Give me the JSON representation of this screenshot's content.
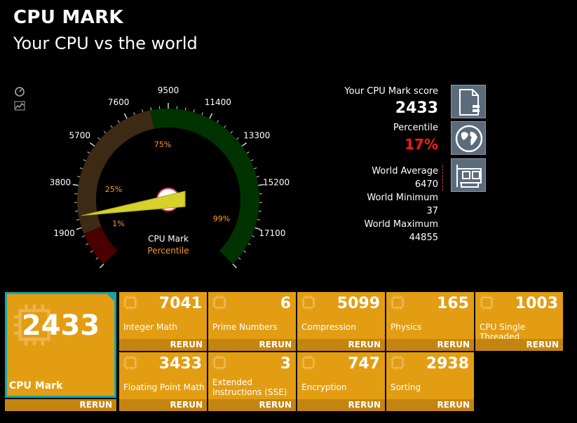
{
  "header": {
    "title": "CPU MARK",
    "subtitle": "Your CPU vs the world"
  },
  "gauge": {
    "ticks": [
      "0",
      "1900",
      "3800",
      "5700",
      "7600",
      "9500",
      "11400",
      "13300",
      "15200",
      "17100",
      "19000"
    ],
    "max": 19000,
    "percentile_marks": [
      "1%",
      "25%",
      "75%",
      "99%"
    ],
    "caption_mark": "CPU Mark",
    "caption_percentile": "Percentile",
    "needle_value": 2433,
    "colors": {
      "low": "#4a0000",
      "mid": "#3d2a14",
      "high": "#003300",
      "needle": "#d6d22a",
      "accent": "#ff8c1a"
    }
  },
  "stats": {
    "score_label": "Your CPU Mark score",
    "score": "2433",
    "percentile_label": "Percentile",
    "percentile": "17%",
    "avg_label": "World Average",
    "avg": "6470",
    "min_label": "World Minimum",
    "min": "37",
    "max_label": "World Maximum",
    "max": "44855"
  },
  "icons": {
    "left": [
      "speedometer-icon",
      "chart-icon"
    ],
    "right": [
      "report-icon",
      "globe-icon",
      "hardware-icon"
    ]
  },
  "main_tile": {
    "value": "2433",
    "label": "CPU Mark",
    "rerun": "RERUN"
  },
  "tests": [
    {
      "value": "7041",
      "label": "Integer Math",
      "rerun": "RERUN"
    },
    {
      "value": "6",
      "label": "Prime Numbers",
      "rerun": "RERUN"
    },
    {
      "value": "5099",
      "label": "Compression",
      "rerun": "RERUN"
    },
    {
      "value": "165",
      "label": "Physics",
      "rerun": "RERUN"
    },
    {
      "value": "1003",
      "label": "CPU Single Threaded",
      "rerun": "RERUN"
    },
    {
      "value": "3433",
      "label": "Floating Point Math",
      "rerun": "RERUN"
    },
    {
      "value": "3",
      "label": "Extended Instructions (SSE)",
      "rerun": "RERUN"
    },
    {
      "value": "747",
      "label": "Encryption",
      "rerun": "RERUN"
    },
    {
      "value": "2938",
      "label": "Sorting",
      "rerun": "RERUN"
    }
  ]
}
